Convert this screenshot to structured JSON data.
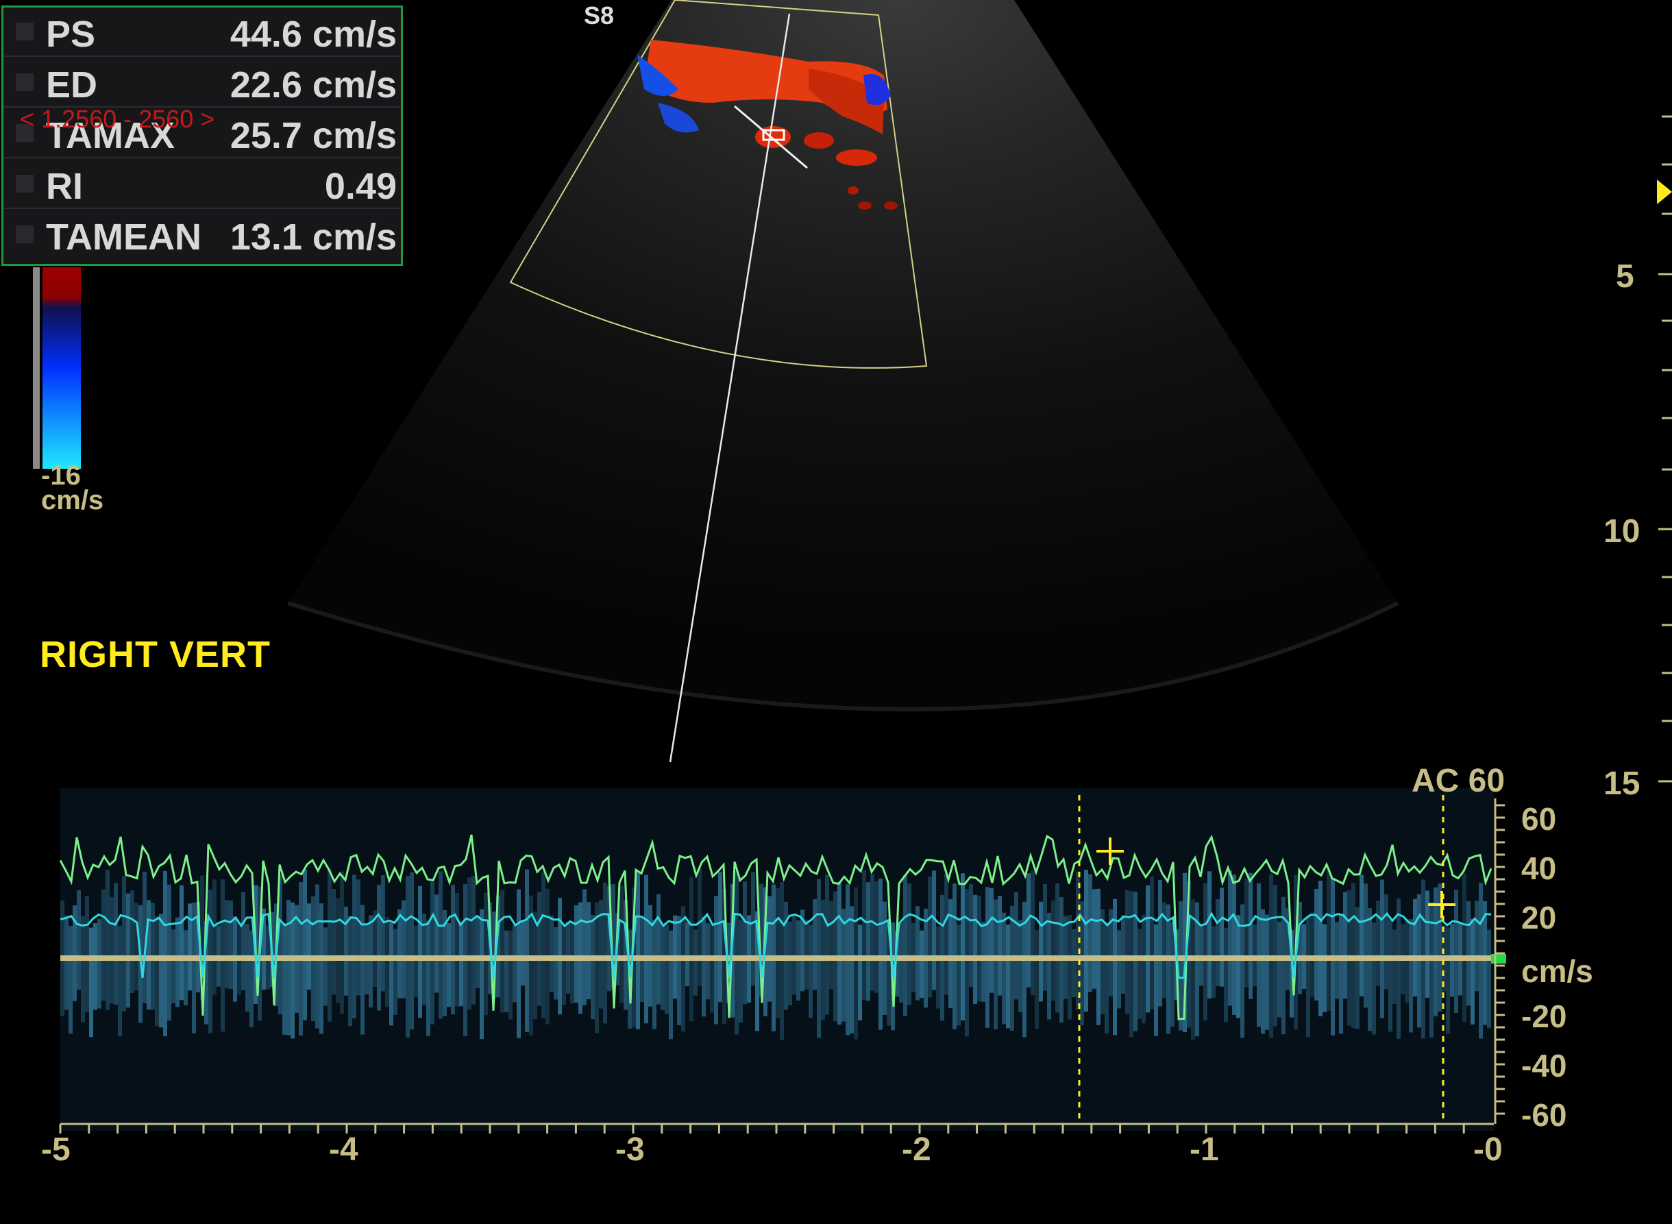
{
  "measurements": [
    {
      "name": "PS",
      "value": "44.6 cm/s"
    },
    {
      "name": "ED",
      "value": "22.6 cm/s"
    },
    {
      "name": "TAMAX",
      "value": "25.7 cm/s"
    },
    {
      "name": "RI",
      "value": "0.49"
    },
    {
      "name": "TAMEAN",
      "value": "13.1 cm/s"
    }
  ],
  "range_note": "< 1.2560 - 2560 >",
  "segment_tag": "S8",
  "vessel_label": "RIGHT VERT",
  "color_scale": {
    "min": "-16",
    "unit": "cm/s"
  },
  "doppler": {
    "ac_label": "AC 60",
    "velocity_ticks": [
      "60",
      "40",
      "20",
      "cm/s",
      "-20",
      "-40",
      "-60"
    ],
    "time_ticks": [
      "-5",
      "-4",
      "-3",
      "-2",
      "-1",
      "-0"
    ]
  },
  "depth_ticks": [
    "5",
    "10",
    "15"
  ],
  "colors": {
    "panel_border": "#1f9a3f",
    "label_yellow": "#ffeb1e",
    "scale_text": "#c7bd86",
    "trace_green": "#7cf08a",
    "trace_cyan": "#30d8e0",
    "spectrum": "#5fb8e0"
  }
}
